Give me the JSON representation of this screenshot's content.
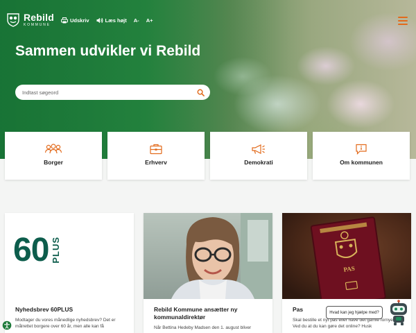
{
  "colors": {
    "brand_green": "#1e7a3a",
    "accent_orange": "#e26a1b",
    "sixty_plus_teal": "#0d5d4c"
  },
  "header": {
    "logo": {
      "name": "Rebild",
      "subtitle": "KOMMUNE",
      "icon": "rebild-crest-icon"
    },
    "tools": [
      {
        "label": "Udskriv",
        "icon": "printer-icon"
      },
      {
        "label": "Læs højt",
        "icon": "speaker-icon"
      },
      {
        "label": "A-"
      },
      {
        "label": "A+"
      }
    ],
    "menu_icon": "hamburger-menu-icon"
  },
  "hero": {
    "headline": "Sammen udvikler vi Rebild",
    "search": {
      "placeholder": "Indtast søgeord",
      "value": "",
      "icon": "search-icon"
    }
  },
  "categories": [
    {
      "label": "Borger",
      "icon": "people-icon"
    },
    {
      "label": "Erhverv",
      "icon": "briefcase-icon"
    },
    {
      "label": "Demokrati",
      "icon": "megaphone-icon"
    },
    {
      "label": "Om kommunen",
      "icon": "info-bubble-icon"
    }
  ],
  "news": [
    {
      "image_text": {
        "number": "60",
        "suffix": "PLUS"
      },
      "title": "Nyhedsbrev 60PLUS",
      "text": "Modtager du vores månedlige nyhedsbrev? Det er målrettet borgere over 60 år, men alle kan få"
    },
    {
      "title": "Rebild Kommune ansætter ny kommunaldirektør",
      "text": "Når Bettina Hedeby Madsen den 1. august bliver"
    },
    {
      "image_text": {
        "passport": "PAS"
      },
      "title": "Pas",
      "text": "Skal bestille et nyt pas eller have det gamle fornyet? Ved du at du kan gøre det online? Husk"
    }
  ],
  "chat": {
    "bubble": "Hvad kan jeg hjælpe med?",
    "icon": "chat-robot-icon"
  },
  "accessibility": {
    "icon": "accessibility-icon"
  }
}
